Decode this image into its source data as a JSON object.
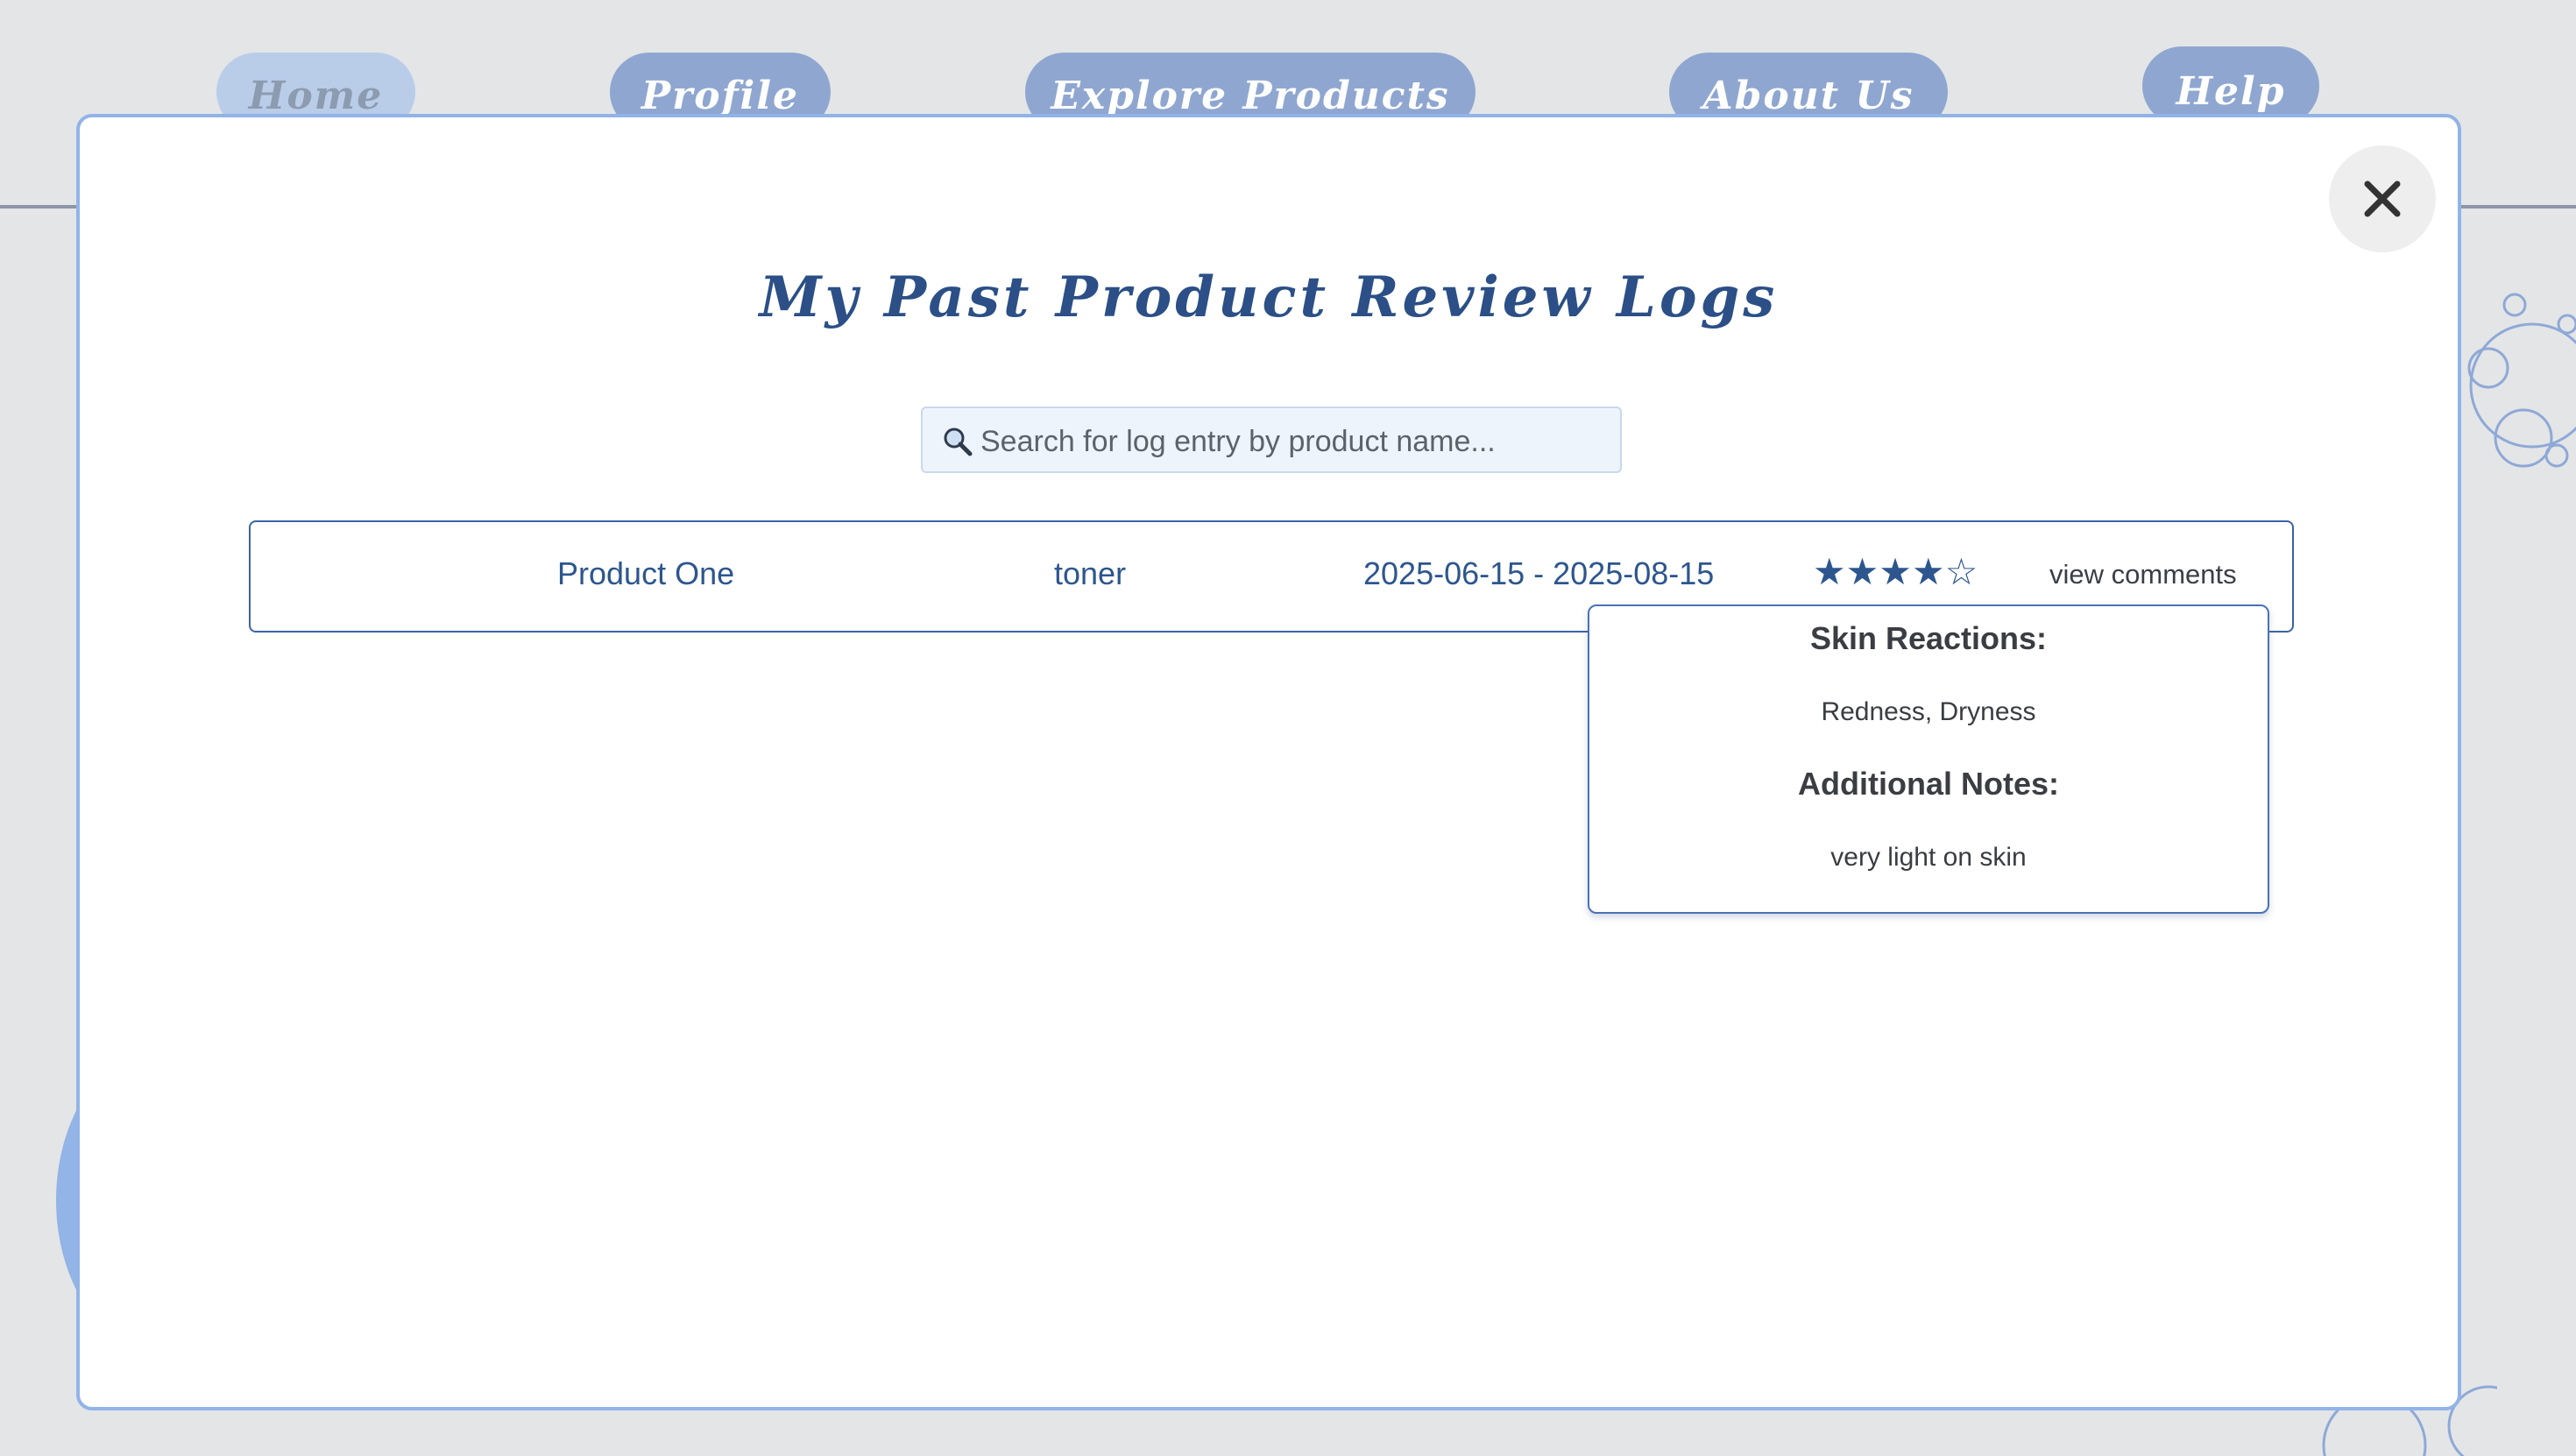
{
  "nav": {
    "items": [
      {
        "label": "Home"
      },
      {
        "label": "Profile"
      },
      {
        "label": "Explore Products"
      },
      {
        "label": "About Us"
      },
      {
        "label": "Help"
      }
    ]
  },
  "modal": {
    "title": "My Past Product Review Logs",
    "close_label": "✕",
    "search": {
      "placeholder": "Search for log entry by product name...",
      "value": ""
    },
    "logs": [
      {
        "product_name": "Product One",
        "product_type": "toner",
        "date_range": "2025-06-15 - 2025-08-15",
        "rating": 4,
        "rating_max": 5,
        "rating_display": "★★★★☆",
        "comments_link": "view comments"
      }
    ],
    "comments_popup": {
      "skin_reactions_heading": "Skin Reactions:",
      "skin_reactions": "Redness, Dryness",
      "notes_heading": "Additional Notes:",
      "notes": "very light on skin"
    }
  },
  "colors": {
    "page_background": "#e4e5e7",
    "nav_button": "#8fa7d0",
    "nav_button_active": "#b9cde9",
    "accent": "#2b4f86",
    "modal_border": "#91b3e8"
  }
}
